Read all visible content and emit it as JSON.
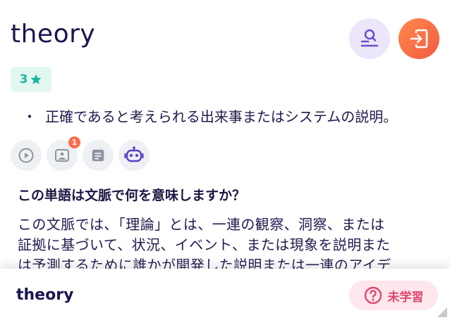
{
  "word": {
    "title": "theory",
    "star_count": "3"
  },
  "definition": {
    "bullet": "・",
    "text": "正確であると考えられる出来事またはシステムの説明。"
  },
  "tools": {
    "image_badge_count": "1"
  },
  "context": {
    "question": "この単語は文脈で何を意味しますか？",
    "lines": [
      "この文脈では、「理論」とは、一連の観察、洞察、または",
      "証拠に基づいて、状況、イベント、または現象を説明また",
      "は予測するために誰かが開発した説明または一連のアイデ"
    ]
  },
  "bottom_bar": {
    "word": "theory",
    "status_label": "未学習"
  },
  "colors": {
    "accent_purple": "#6b4fc8",
    "accent_orange": "#f25a43",
    "star_green": "#1bb89d",
    "status_pink": "#e0486e"
  },
  "icons": {
    "lookup": "search-list-icon",
    "exit": "exit-icon",
    "star": "star-icon",
    "audio": "play-icon",
    "image": "image-icon",
    "notes": "notes-icon",
    "ai": "robot-icon",
    "status": "question-icon"
  }
}
